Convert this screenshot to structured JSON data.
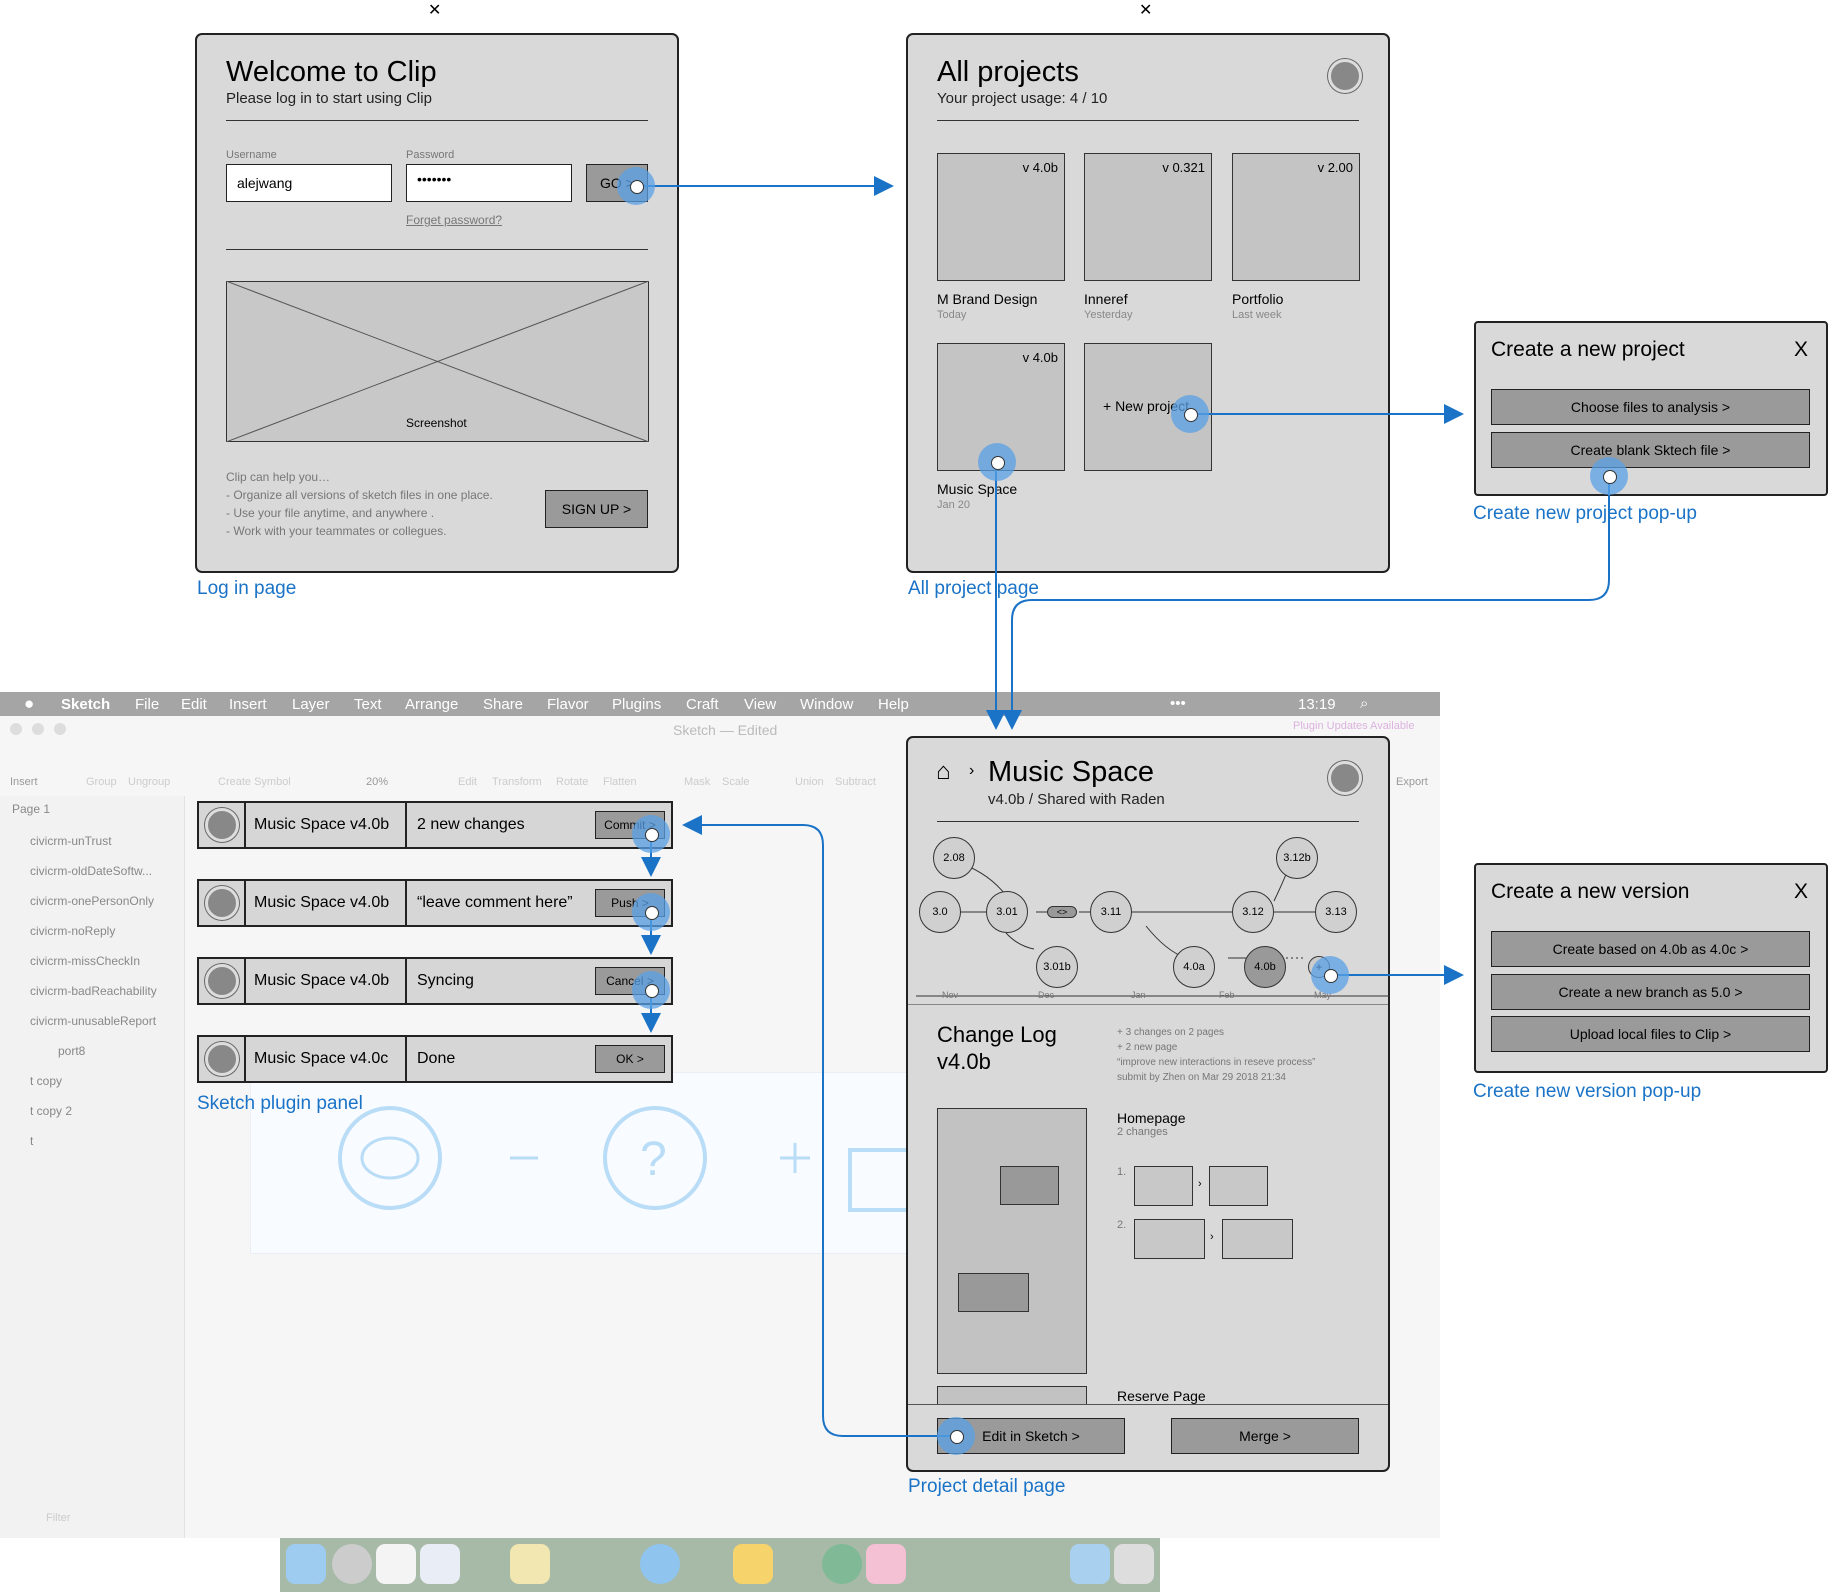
{
  "login": {
    "title": "Welcome to Clip",
    "subtitle": "Please log in to start using Clip",
    "username_label": "Username",
    "username_value": "alejwang",
    "password_label": "Password",
    "password_value": "•••••••",
    "go": "GO >",
    "forget": "Forget password?",
    "screenshot": "Screenshot",
    "help_title": "Clip can help you…",
    "help_1": "- Organize all versions of sketch files in one place.",
    "help_2": "- Use your file anytime, and anywhere .",
    "help_3": "- Work with your teammates or collegues.",
    "signup": "SIGN UP >",
    "caption": "Log in page"
  },
  "projects": {
    "title": "All projects",
    "subtitle": "Your project usage: 4 / 10",
    "items": [
      {
        "version": "v 4.0b",
        "name": "M Brand Design",
        "date": "Today"
      },
      {
        "version": "v 0.321",
        "name": "Inneref",
        "date": "Yesterday"
      },
      {
        "version": "v 2.00",
        "name": "Portfolio",
        "date": "Last week"
      },
      {
        "version": "v 4.0b",
        "name": "Music Space",
        "date": "Jan 20"
      }
    ],
    "new_project": "+ New project",
    "caption": "All project page"
  },
  "new_project_popup": {
    "title": "Create a new project",
    "close": "X",
    "btn1": "Choose files to analysis >",
    "btn2": "Create blank Sktech file >",
    "caption": "Create new project pop-up"
  },
  "new_version_popup": {
    "title": "Create a new version",
    "close": "X",
    "btn1": "Create based on 4.0b as 4.0c >",
    "btn2": "Create a new branch as 5.0 >",
    "btn3": "Upload local files to Clip >",
    "caption": "Create new version pop-up"
  },
  "detail": {
    "title": "Music Space",
    "subtitle": "v4.0b / Shared with Raden",
    "nodes": [
      "2.08",
      "3.0",
      "3.01",
      "<>",
      "3.11",
      "3.12",
      "3.12b",
      "3.13",
      "3.01b",
      "4.0a",
      "4.0b",
      "+"
    ],
    "months": [
      "Nov",
      "Dec",
      "Jan",
      "Feb",
      "May"
    ],
    "changelog_title": "Change Log",
    "changelog_version": "v4.0b",
    "log_1": "+ 3 changes on 2 pages",
    "log_2": "+ 2 new page",
    "log_3": "“improve new interactions in reseve process”",
    "log_4": "submit by Zhen on Mar 29 2018 21:34",
    "page1_title": "Homepage",
    "page1_sub": "2 changes",
    "change_1": "1.",
    "change_2": "2.",
    "page2_title": "Reserve Page",
    "edit": "Edit in Sketch >",
    "merge": "Merge >",
    "caption": "Project detail page"
  },
  "plugin": {
    "rows": [
      {
        "name": "Music Space v4.0b",
        "status": "2 new changes",
        "button": "Commit >"
      },
      {
        "name": "Music Space v4.0b",
        "status": "“leave comment here”",
        "button": "Push >"
      },
      {
        "name": "Music Space v4.0b",
        "status": "Syncing",
        "button": "Cancel >"
      },
      {
        "name": "Music Space v4.0c",
        "status": "Done",
        "button": "OK >"
      }
    ],
    "caption": "Sketch plugin panel"
  },
  "sketch": {
    "menu": [
      "Sketch",
      "File",
      "Edit",
      "Insert",
      "Layer",
      "Text",
      "Arrange",
      "Share",
      "Flavor",
      "Plugins",
      "Craft",
      "View",
      "Window",
      "Help"
    ],
    "clock": "13:19",
    "window_title": "Sketch — Edited",
    "plugin_updates": "Plugin Updates Available",
    "toolbar": [
      "Insert",
      "Group",
      "Ungroup",
      "Create Symbol",
      "20%",
      "Edit",
      "Transform",
      "Rotate",
      "Flatten",
      "Mask",
      "Scale",
      "Union",
      "Subtract",
      "Export"
    ],
    "page": "Page 1",
    "layers": [
      "civicrm-unTrust",
      "civicrm-oldDateSoftw...",
      "civicrm-onePersonOnly",
      "civicrm-noReply",
      "civicrm-missCheckIn",
      "civicrm-badReachability",
      "civicrm-unusableReport",
      "port8",
      "t copy",
      "t copy 2",
      "t"
    ],
    "filter": "Filter"
  },
  "colors": {
    "accent": "#1a73c7",
    "panel": "#d9d9d9",
    "button": "#9a9a9a",
    "dot": "#5aa0e6"
  }
}
